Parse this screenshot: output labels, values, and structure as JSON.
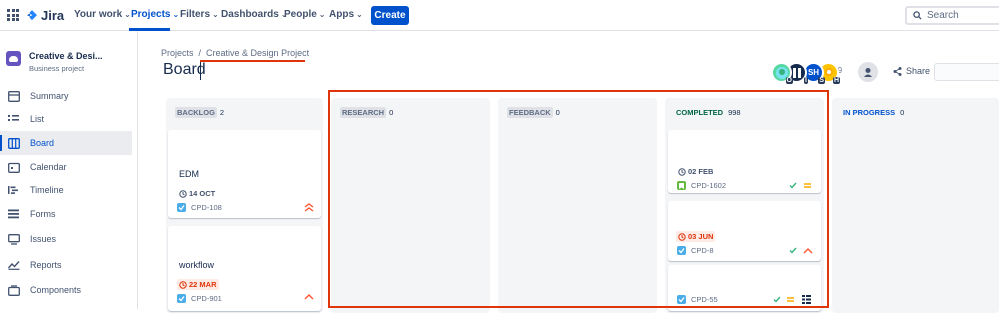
{
  "topnav": {
    "logo_text": "Jira",
    "items": [
      {
        "label": "Your work"
      },
      {
        "label": "Projects"
      },
      {
        "label": "Filters"
      },
      {
        "label": "Dashboards"
      },
      {
        "label": "People"
      },
      {
        "label": "Apps"
      }
    ],
    "create_label": "Create",
    "search_placeholder": "Search",
    "accent": "#0052CC"
  },
  "sidebar": {
    "project_name": "Creative & Desi...",
    "project_type": "Business project",
    "items": [
      {
        "label": "Summary",
        "icon": "summary-icon"
      },
      {
        "label": "List",
        "icon": "list-icon"
      },
      {
        "label": "Board",
        "icon": "board-icon",
        "active": true
      },
      {
        "label": "Calendar",
        "icon": "calendar-icon"
      },
      {
        "label": "Timeline",
        "icon": "timeline-icon"
      },
      {
        "label": "Forms",
        "icon": "forms-icon"
      },
      {
        "label": "Issues",
        "icon": "issues-icon"
      },
      {
        "label": "Reports",
        "icon": "reports-icon"
      },
      {
        "label": "Components",
        "icon": "components-icon"
      }
    ]
  },
  "breadcrumb": {
    "root": "Projects",
    "separator": "/",
    "project": "Creative & Design Project"
  },
  "page_title": "Board",
  "header_actions": {
    "avatars": [
      {
        "initials": "",
        "badge": "O"
      },
      {
        "initials": "",
        "badge": "I"
      },
      {
        "initials": "SH",
        "badge": "S"
      },
      {
        "initials": "",
        "badge": "H"
      }
    ],
    "more_count": "+9",
    "share_label": "Share"
  },
  "columns": [
    {
      "name": "BACKLOG",
      "count": "2"
    },
    {
      "name": "RESEARCH",
      "count": "0"
    },
    {
      "name": "FEEDBACK",
      "count": "0"
    },
    {
      "name": "COMPLETED",
      "count": "998"
    },
    {
      "name": "IN PROGRESS",
      "count": "0"
    }
  ],
  "cards": {
    "backlog": [
      {
        "title": "EDM",
        "date": "14 OCT",
        "key": "CPD-108",
        "priority": "highest-icon"
      },
      {
        "title": "workflow",
        "date": "22 MAR",
        "key": "CPD-901",
        "priority": "high-icon"
      }
    ],
    "completed": [
      {
        "date": "02 FEB",
        "key": "CPD-1602",
        "priority": "medium-icon"
      },
      {
        "date": "03 JUN",
        "key": "CPD-8",
        "priority": "high-icon"
      },
      {
        "key": "CPD-55",
        "priority": "medium-icon"
      }
    ]
  },
  "colors": {
    "highlight": "#DE350B",
    "done": "#006644",
    "overdue": "#DE350B"
  }
}
